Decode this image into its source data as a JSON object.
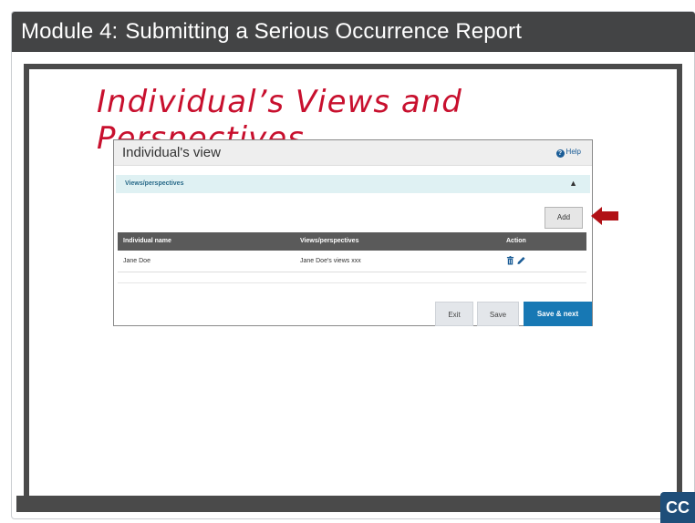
{
  "module_header": {
    "prefix": "Module 4:",
    "title": "Submitting a Serious Occurrence Report"
  },
  "slide": {
    "title": "Individual’s Views and Perspectives"
  },
  "form": {
    "title": "Individual's view",
    "help_label": "Help",
    "section_label": "Views/perspectives",
    "add_label": "Add",
    "columns": [
      "Individual name",
      "Views/perspectives",
      "Action"
    ],
    "rows": [
      {
        "name": "Jane Doe",
        "view": "Jane Doe's views xxx"
      }
    ],
    "buttons": {
      "exit": "Exit",
      "save": "Save",
      "save_next": "Save & next"
    }
  },
  "cc_label": "CC",
  "colors": {
    "header_bg": "#434445",
    "title_red": "#c8102e",
    "primary_blue": "#1778b4",
    "arrow_red": "#b11116"
  },
  "icons": [
    "help-icon",
    "chevron-up-icon",
    "arrow-left-icon",
    "trash-icon",
    "pencil-icon"
  ]
}
